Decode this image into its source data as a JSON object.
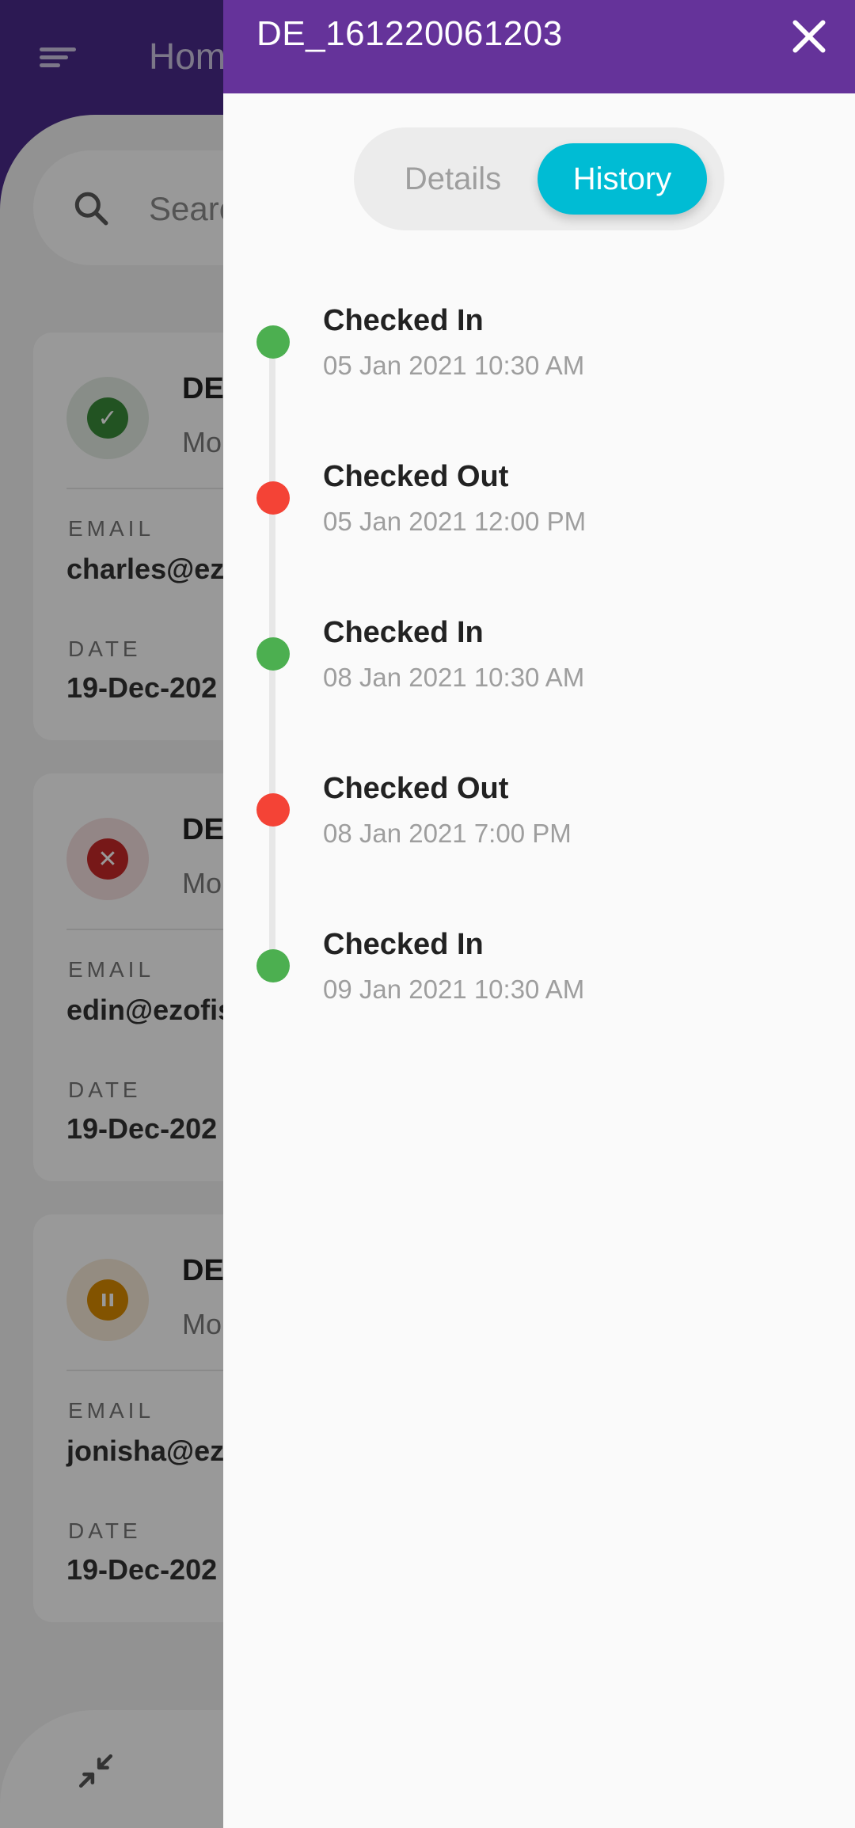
{
  "background": {
    "header_title": "Hom",
    "search_placeholder": "Searc",
    "cards": [
      {
        "id": "DE",
        "subtitle": "Mo",
        "status": "approved",
        "status_icon": "check-icon",
        "email_label": "EMAIL",
        "email": "charles@ez",
        "date_label": "DATE",
        "date": "19-Dec-202"
      },
      {
        "id": "DE",
        "subtitle": "Mo",
        "status": "rejected",
        "status_icon": "close-icon",
        "email_label": "EMAIL",
        "email": "edin@ezofis",
        "date_label": "DATE",
        "date": "19-Dec-202"
      },
      {
        "id": "DE",
        "subtitle": "Mo",
        "status": "paused",
        "status_icon": "pause-icon",
        "email_label": "EMAIL",
        "email": "jonisha@ez",
        "date_label": "DATE",
        "date": "19-Dec-202"
      }
    ]
  },
  "drawer": {
    "title": "DE_161220061203",
    "tabs": [
      {
        "label": "Details",
        "active": false
      },
      {
        "label": "History",
        "active": true
      }
    ],
    "history": [
      {
        "title": "Checked In",
        "time": "05 Jan 2021 10:30 AM",
        "color": "#4caf50"
      },
      {
        "title": "Checked Out",
        "time": "05 Jan 2021 12:00 PM",
        "color": "#f44336"
      },
      {
        "title": "Checked In",
        "time": "08 Jan 2021 10:30 AM",
        "color": "#4caf50"
      },
      {
        "title": "Checked Out",
        "time": "08 Jan 2021 7:00 PM",
        "color": "#f44336"
      },
      {
        "title": "Checked In",
        "time": "09 Jan 2021 10:30 AM",
        "color": "#4caf50"
      }
    ]
  },
  "colors": {
    "header_purple": "#65339a",
    "accent_cyan": "#00bcd4",
    "checked_in_green": "#4caf50",
    "checked_out_red": "#f44336"
  }
}
